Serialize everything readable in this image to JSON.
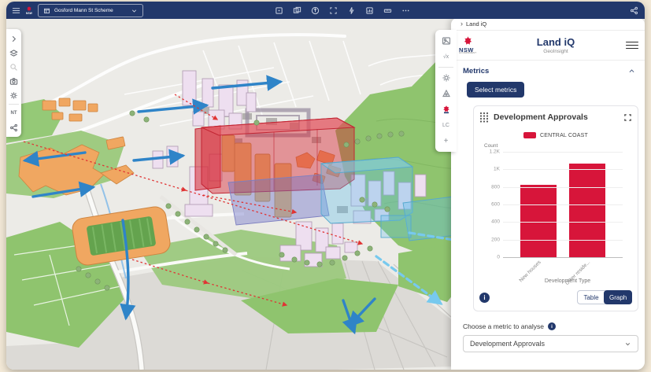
{
  "colors": {
    "navy": "#22386b",
    "red": "#d7153a",
    "map-green": "#8fc46e",
    "map-orange": "#f0a761",
    "arrow-blue": "#2f84c8"
  },
  "top_bar": {
    "scheme_selector": "Gosford Mann St Scheme",
    "icons": [
      "menu",
      "nsw-logo",
      "frame",
      "basemap-layers",
      "orientation",
      "extent",
      "run",
      "report",
      "measure",
      "more",
      "share"
    ]
  },
  "map_toolbar": {
    "items": [
      "expand",
      "layers",
      "search",
      "camera",
      "settings",
      "nt",
      "share-nodes"
    ],
    "nt_label": "NT"
  },
  "widget_toolbar": {
    "items": [
      "scene",
      "function",
      "brightness",
      "prism",
      "landiq",
      "layer-control",
      "add"
    ],
    "sqrt_label": "√x",
    "lc_label": "LC",
    "plus_label": "+"
  },
  "panel": {
    "breadcrumb": "Land iQ",
    "breadcrumb_chevron": "›",
    "header": {
      "logo_line1": "NSW",
      "logo_line2": "GOVERNMENT",
      "title": "Land iQ",
      "subtitle": "GeoInsight"
    },
    "metrics": {
      "section_label": "Metrics",
      "select_button_label": "Select metrics",
      "card": {
        "title": "Development Approvals",
        "legend_label": "CENTRAL COAST",
        "info_label": "i",
        "toggle": {
          "table_label": "Table",
          "graph_label": "Graph",
          "selected": "Graph"
        }
      }
    },
    "metric_chooser": {
      "label": "Choose a metric to analyse",
      "info_label": "i",
      "value": "Development Approvals"
    }
  },
  "chart_data": {
    "type": "bar",
    "title": "Development Approvals",
    "categories": [
      "New houses",
      "Other reside..."
    ],
    "series": [
      {
        "name": "CENTRAL COAST",
        "color": "#d7153a",
        "values": [
          820,
          1065
        ]
      }
    ],
    "xlabel": "Development Type",
    "ylabel": "Count",
    "ylim": [
      0,
      1200
    ],
    "yticks": [
      {
        "label": "1.2K",
        "value": 1200
      },
      {
        "label": "1K",
        "value": 1000
      },
      {
        "label": "800",
        "value": 800
      },
      {
        "label": "600",
        "value": 600
      },
      {
        "label": "400",
        "value": 400
      },
      {
        "label": "200",
        "value": 200
      },
      {
        "label": "0",
        "value": 0
      }
    ],
    "grid": true,
    "legend_position": "top"
  }
}
